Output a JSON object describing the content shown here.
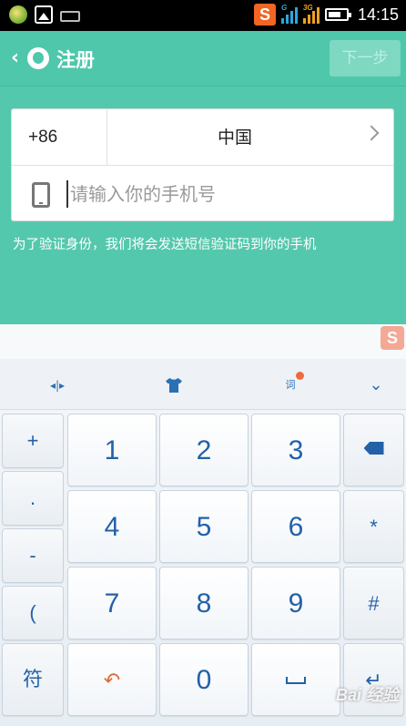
{
  "status_bar": {
    "time": "14:15",
    "sogou_badge": "S",
    "signal1_tag": "G",
    "signal2_tag": "3G"
  },
  "header": {
    "back_icon": "chevron-left-icon",
    "title": "注册",
    "next_label": "下一步"
  },
  "form": {
    "country_code": "+86",
    "country_name": "中国",
    "phone_placeholder": "请输入你的手机号",
    "phone_value": "",
    "hint": "为了验证身份，我们将会发送短信验证码到你的手机"
  },
  "keyboard": {
    "logo": "S",
    "toolbar": {
      "cursor_icon": "◂|▸",
      "ci_label": "词",
      "collapse_icon": "⌄"
    },
    "side_keys": [
      "+",
      ".",
      "-",
      "("
    ],
    "symbol_key": "符",
    "digits": [
      "1",
      "2",
      "3",
      "4",
      "5",
      "6",
      "7",
      "8",
      "9",
      "0"
    ],
    "right_keys": [
      "*",
      "#"
    ]
  },
  "watermark": "Bai 经验",
  "colors": {
    "primary": "#4ec7aa",
    "key_text": "#2361a8",
    "sogou_orange": "#f26522"
  }
}
